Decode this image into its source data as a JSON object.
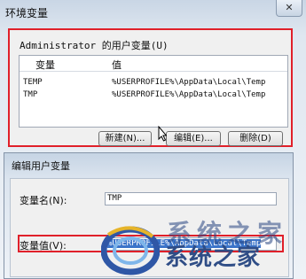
{
  "window": {
    "title": "环境变量",
    "close_label": "✕"
  },
  "user_vars": {
    "group_label": "Administrator 的用户变量(U)",
    "columns": [
      "变量",
      "值"
    ],
    "rows": [
      {
        "name": "TEMP",
        "value": "%USERPROFILE%\\AppData\\Local\\Temp"
      },
      {
        "name": "TMP",
        "value": "%USERPROFILE%\\AppData\\Local\\Temp"
      }
    ],
    "buttons": {
      "new_label": "新建(N)...",
      "edit_label": "编辑(E)...",
      "delete_label": "删除(D)"
    }
  },
  "edit_dialog": {
    "title": "编辑用户变量",
    "name_label": "变量名(N):",
    "name_value": "TMP",
    "value_label": "变量值(V):",
    "value_value": "%USERPROFILE%\\AppData\\Local\\Temp"
  },
  "watermark": {
    "text": "系统之家",
    "faded_text": "系统之家"
  },
  "colors": {
    "highlight": "#e0202a",
    "selection": "#3b74c9",
    "brand": "#2f4d86"
  }
}
